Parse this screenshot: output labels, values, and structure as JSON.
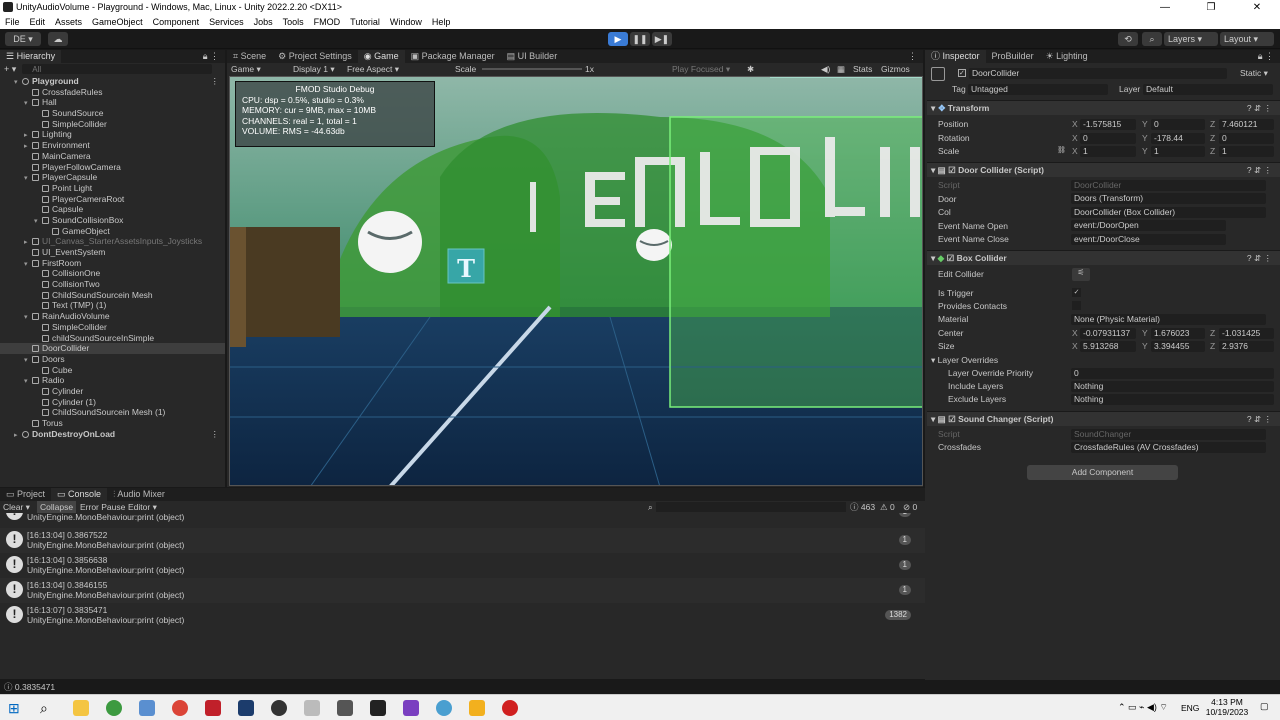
{
  "window": {
    "title": "UnityAudioVolume - Playground - Windows, Mac, Linux - Unity 2022.2.20 <DX11>"
  },
  "menu": [
    "File",
    "Edit",
    "Assets",
    "GameObject",
    "Component",
    "Services",
    "Jobs",
    "Tools",
    "FMOD",
    "Tutorial",
    "Window",
    "Help"
  ],
  "toolbar": {
    "account": "DE",
    "layers": "Layers",
    "layout": "Layout"
  },
  "hierarchy": {
    "tab": "Hierarchy",
    "search_placeholder": "All",
    "items": [
      {
        "label": "Playground",
        "depth": 0,
        "expanded": true,
        "scene": true
      },
      {
        "label": "CrossfadeRules",
        "depth": 1
      },
      {
        "label": "Hall",
        "depth": 1,
        "expanded": true
      },
      {
        "label": "SoundSource",
        "depth": 2
      },
      {
        "label": "SimpleCollider",
        "depth": 2
      },
      {
        "label": "Lighting",
        "depth": 1,
        "collapsed": true
      },
      {
        "label": "Environment",
        "depth": 1,
        "collapsed": true
      },
      {
        "label": "MainCamera",
        "depth": 1
      },
      {
        "label": "PlayerFollowCamera",
        "depth": 1
      },
      {
        "label": "PlayerCapsule",
        "depth": 1,
        "expanded": true
      },
      {
        "label": "Point Light",
        "depth": 2
      },
      {
        "label": "PlayerCameraRoot",
        "depth": 2
      },
      {
        "label": "Capsule",
        "depth": 2
      },
      {
        "label": "SoundCollisionBox",
        "depth": 2,
        "expanded": true
      },
      {
        "label": "GameObject",
        "depth": 3
      },
      {
        "label": "UI_Canvas_StarterAssetsInputs_Joysticks",
        "depth": 1,
        "collapsed": true,
        "dim": true
      },
      {
        "label": "UI_EventSystem",
        "depth": 1
      },
      {
        "label": "FirstRoom",
        "depth": 1,
        "expanded": true
      },
      {
        "label": "CollisionOne",
        "depth": 2
      },
      {
        "label": "CollisionTwo",
        "depth": 2
      },
      {
        "label": "ChildSoundSourcein Mesh",
        "depth": 2
      },
      {
        "label": "Text (TMP) (1)",
        "depth": 2
      },
      {
        "label": "RainAudioVolume",
        "depth": 1,
        "expanded": true
      },
      {
        "label": "SimpleCollider",
        "depth": 2
      },
      {
        "label": "childSoundSourceInSimple",
        "depth": 2
      },
      {
        "label": "DoorCollider",
        "depth": 1,
        "selected": true
      },
      {
        "label": "Doors",
        "depth": 1,
        "expanded": true
      },
      {
        "label": "Cube",
        "depth": 2
      },
      {
        "label": "Radio",
        "depth": 1,
        "expanded": true
      },
      {
        "label": "Cylinder",
        "depth": 2
      },
      {
        "label": "Cylinder (1)",
        "depth": 2
      },
      {
        "label": "ChildSoundSourcein Mesh (1)",
        "depth": 2
      },
      {
        "label": "Torus",
        "depth": 1
      },
      {
        "label": "DontDestroyOnLoad",
        "depth": 0,
        "collapsed": true,
        "scene": true
      }
    ]
  },
  "center_tabs": [
    "Scene",
    "Project Settings",
    "Game",
    "Package Manager",
    "UI Builder"
  ],
  "game_bar": {
    "view": "Game",
    "display": "Display 1",
    "aspect": "Free Aspect",
    "scale_label": "Scale",
    "scale_value": "1x",
    "play_focused": "Play Focused",
    "stats": "Stats",
    "gizmos": "Gizmos"
  },
  "fmod": {
    "title": "FMOD Studio Debug",
    "lines": [
      "CPU: dsp = 0.5%, studio = 0.3%",
      "MEMORY: cur = 9MB, max = 10MB",
      "CHANNELS: real = 1, total = 1",
      "VOLUME: RMS = -44.63db"
    ]
  },
  "inspector": {
    "tabs": [
      "Inspector",
      "ProBuilder",
      "Lighting"
    ],
    "object_name": "DoorCollider",
    "static": "Static",
    "tag_label": "Tag",
    "tag": "Untagged",
    "layer_label": "Layer",
    "layer": "Default",
    "transform": {
      "title": "Transform",
      "position": {
        "label": "Position",
        "x": "-1.575815",
        "y": "0",
        "z": "7.460121"
      },
      "rotation": {
        "label": "Rotation",
        "x": "0",
        "y": "-178.44",
        "z": "0"
      },
      "scale": {
        "label": "Scale",
        "x": "1",
        "y": "1",
        "z": "1"
      }
    },
    "door_collider": {
      "title": "Door Collider (Script)",
      "script_label": "Script",
      "script": "DoorCollider",
      "door_label": "Door",
      "door": "Doors (Transform)",
      "col_label": "Col",
      "col": "DoorCollider (Box Collider)",
      "open_label": "Event Name Open",
      "open": "event:/DoorOpen",
      "close_label": "Event Name Close",
      "close": "event:/DoorClose"
    },
    "box_collider": {
      "title": "Box Collider",
      "edit_label": "Edit Collider",
      "trigger_label": "Is Trigger",
      "contacts_label": "Provides Contacts",
      "material_label": "Material",
      "material": "None (Physic Material)",
      "center_label": "Center",
      "cx": "-0.07931137",
      "cy": "1.676023",
      "cz": "-1.031425",
      "size_label": "Size",
      "sx": "5.913268",
      "sy": "3.394455",
      "sz": "2.9376",
      "overrides_label": "Layer Overrides",
      "priority_label": "Layer Override Priority",
      "priority": "0",
      "include_label": "Include Layers",
      "include": "Nothing",
      "exclude_label": "Exclude Layers",
      "exclude": "Nothing"
    },
    "sound_changer": {
      "title": "Sound Changer (Script)",
      "script_label": "Script",
      "script": "SoundChanger",
      "cross_label": "Crossfades",
      "cross": "CrossfadeRules (AV Crossfades)"
    },
    "add_component": "Add Component"
  },
  "bottom": {
    "tabs": [
      "Project",
      "Console",
      "Audio Mixer"
    ],
    "buttons": [
      "Clear",
      "Collapse",
      "Error Pause",
      "Editor"
    ],
    "counts": {
      "log": "463",
      "warn": "0",
      "err": "0"
    },
    "logs": [
      {
        "line1": "",
        "line2": "UnityEngine.MonoBehaviour:print (object)",
        "count": "1"
      },
      {
        "line1": "[16:13:04] 0.3867522",
        "line2": "UnityEngine.MonoBehaviour:print (object)",
        "count": "1"
      },
      {
        "line1": "[16:13:04] 0.3856638",
        "line2": "UnityEngine.MonoBehaviour:print (object)",
        "count": "1"
      },
      {
        "line1": "[16:13:04] 0.3846155",
        "line2": "UnityEngine.MonoBehaviour:print (object)",
        "count": "1"
      },
      {
        "line1": "[16:13:07] 0.3835471",
        "line2": "UnityEngine.MonoBehaviour:print (object)",
        "count": "1382"
      }
    ]
  },
  "status_text": "0.3835471",
  "taskbar": {
    "lang": "ENG",
    "time": "4:13 PM",
    "date": "10/19/2023"
  },
  "colors": {
    "accent": "#3a7bd5",
    "sky": "#3a6a5a",
    "floor": "#0e2a4a",
    "grid": "#4cd34c"
  }
}
